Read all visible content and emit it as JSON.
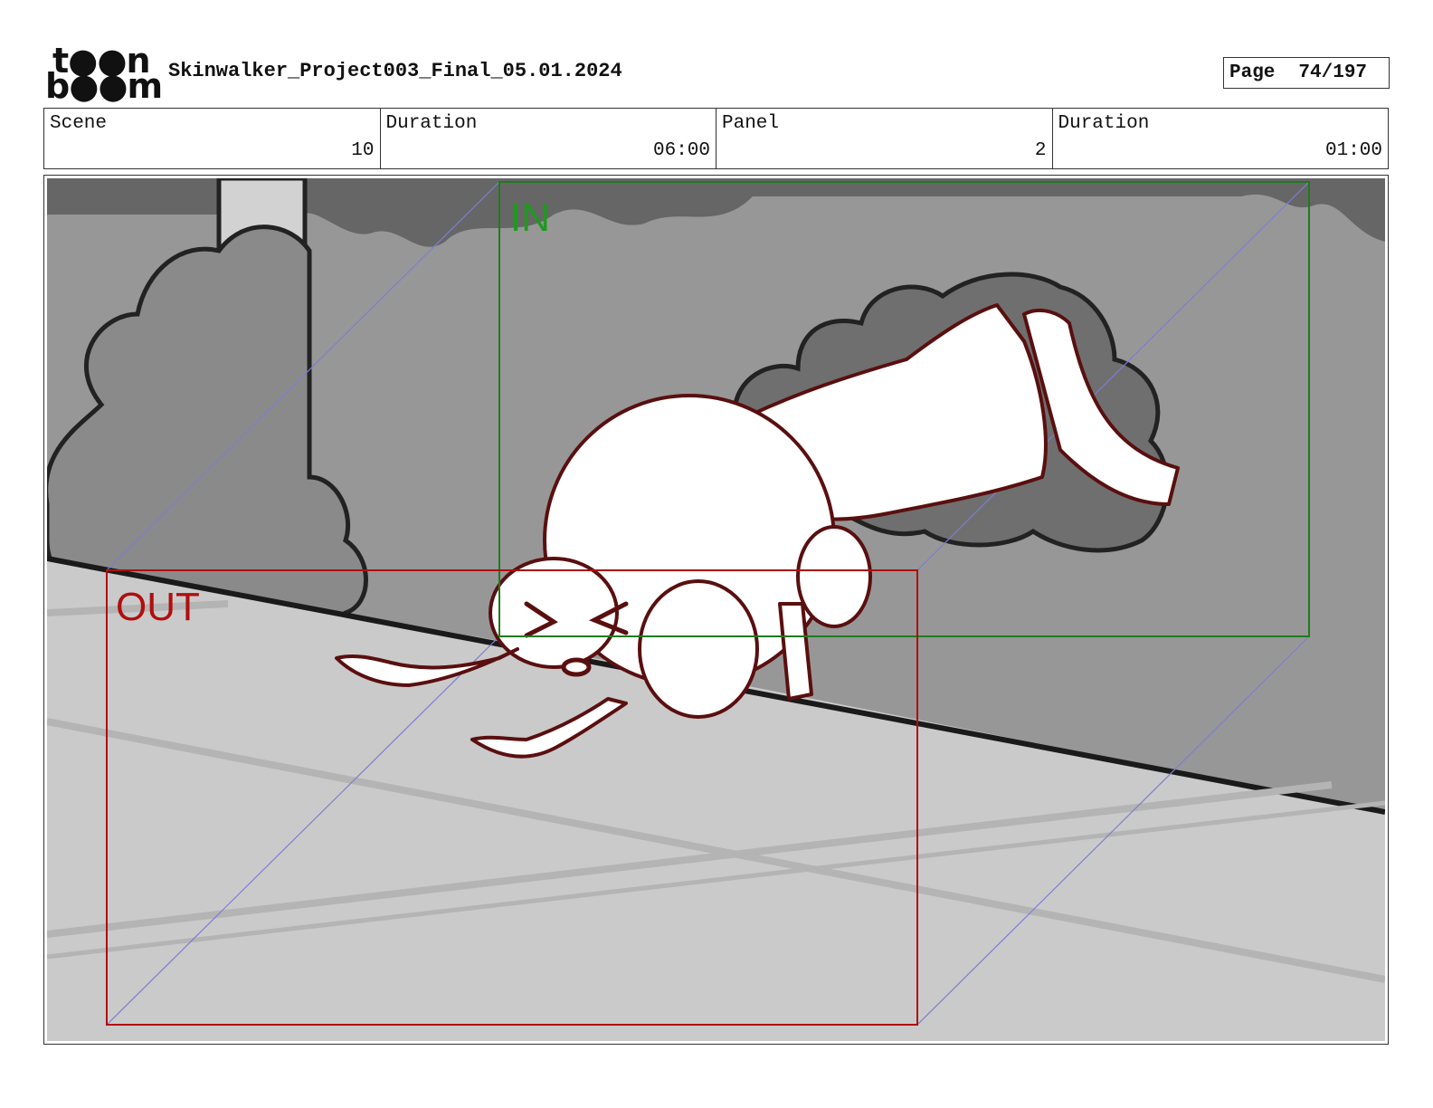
{
  "header": {
    "logo_text": "toon boom",
    "document_title": "Skinwalker_Project003_Final_05.01.2024",
    "page_label": "Page",
    "page_value": "74/197"
  },
  "info": {
    "scene_label": "Scene",
    "scene_value": "10",
    "scene_duration_label": "Duration",
    "scene_duration_value": "06:00",
    "panel_label": "Panel",
    "panel_value": "2",
    "panel_duration_label": "Duration",
    "panel_duration_value": "01:00"
  },
  "panel": {
    "in_frame_label": "IN",
    "out_frame_label": "OUT",
    "in_frame_color": "#1f7a1f",
    "out_frame_color": "#b00e0e",
    "character_line_color": "#5a0f0f"
  }
}
